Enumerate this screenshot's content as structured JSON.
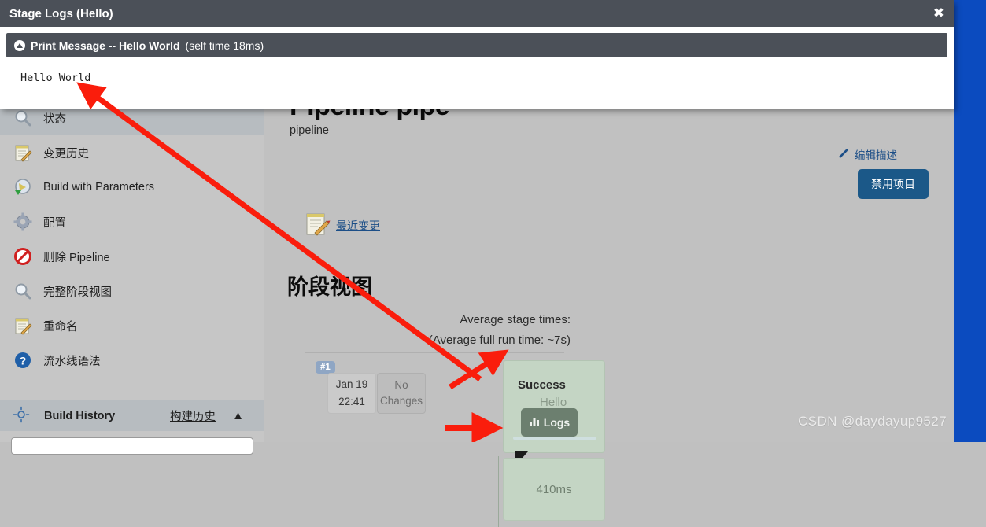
{
  "modal": {
    "title": "Stage Logs (Hello)",
    "close_icon": "close-icon",
    "log_entry": {
      "icon": "play-circle-icon",
      "main": "Print Message -- Hello World",
      "sub": "(self time 18ms)"
    },
    "log_output": "Hello World"
  },
  "sidebar": {
    "items": [
      {
        "label": "状态",
        "icon": "magnifier-icon",
        "highlight": true
      },
      {
        "label": "变更历史",
        "icon": "notepad-pencil-icon",
        "highlight": false
      },
      {
        "label": "Build with Parameters",
        "icon": "build-params-icon",
        "highlight": false
      },
      {
        "label": "配置",
        "icon": "gear-icon",
        "highlight": false
      },
      {
        "label": "删除 Pipeline",
        "icon": "no-entry-icon",
        "highlight": false
      },
      {
        "label": "完整阶段视图",
        "icon": "magnifier-icon",
        "highlight": false
      },
      {
        "label": "重命名",
        "icon": "notepad-pencil-icon",
        "highlight": false
      },
      {
        "label": "流水线语法",
        "icon": "help-circle-icon",
        "highlight": false
      }
    ],
    "build_history": {
      "icon": "sun-icon",
      "label": "Build History",
      "cn_link": "构建历史",
      "chevron": "▲"
    }
  },
  "main": {
    "project_title": "Pipeline pipe",
    "project_description": "pipeline",
    "edit_description": {
      "label": "编辑描述",
      "icon": "pencil-icon"
    },
    "disable_button": "禁用项目",
    "recent_changes": {
      "label": "最近变更",
      "icon": "notepad-pencil-icon"
    },
    "stage_view_heading": "阶段视图",
    "average_stage_times": "Average stage times:",
    "average_full_run": {
      "prefix": "(Average ",
      "underlined": "full",
      "suffix": " run time: ~7s)"
    },
    "build_row": {
      "badge": "#1",
      "date": "Jan 19",
      "time": "22:41",
      "changes_line1": "No",
      "changes_line2": "Changes"
    },
    "stage_tooltip": {
      "status": "Success",
      "stage_name": "Hello",
      "duration": "410ms",
      "logs_button": "Logs",
      "logs_icon": "bar-chart-icon"
    },
    "stage_cell_duration": "410ms"
  },
  "watermark": "CSDN @daydayup9527",
  "colors": {
    "modal_header": "#4b5058",
    "page_bg": "#c1c1c1",
    "sidebar_bg": "#c6c6c6",
    "accent_blue": "#1b5888",
    "link_blue": "#1b4e87",
    "stage_green": "#c4d5c4",
    "annotation_red": "#fa1d0c",
    "right_strip_blue": "#0b4bbf"
  }
}
